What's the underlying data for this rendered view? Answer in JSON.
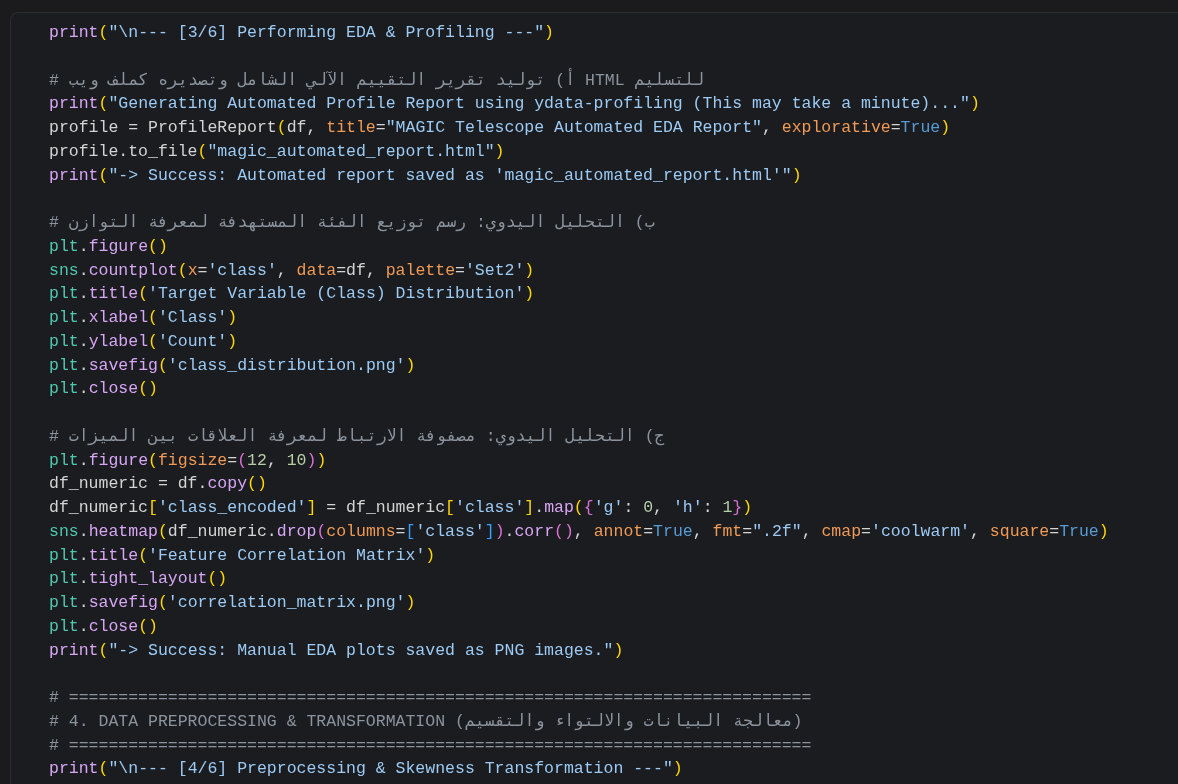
{
  "cell": {
    "lines": [
      {
        "kind": "code",
        "tokens": [
          {
            "kind": "fn",
            "text": "print"
          },
          {
            "kind": "p1",
            "text": "("
          },
          {
            "kind": "str",
            "text": "\"\\n--- [3/6] Performing EDA & Profiling ---\""
          },
          {
            "kind": "p1",
            "text": ")"
          }
        ]
      },
      {
        "kind": "blank"
      },
      {
        "kind": "comment",
        "text": "# أ) توليد تقرير التقييم الآلي الشامل وتصديره كملف ويب HTML للتسليم"
      },
      {
        "kind": "code",
        "tokens": [
          {
            "kind": "fn",
            "text": "print"
          },
          {
            "kind": "p1",
            "text": "("
          },
          {
            "kind": "str",
            "text": "\"Generating Automated Profile Report using ydata-profiling (This may take a minute)...\""
          },
          {
            "kind": "p1",
            "text": ")"
          }
        ]
      },
      {
        "kind": "code",
        "tokens": [
          {
            "kind": "plain",
            "text": "profile = ProfileReport"
          },
          {
            "kind": "p1",
            "text": "("
          },
          {
            "kind": "plain",
            "text": "df, "
          },
          {
            "kind": "kw",
            "text": "title"
          },
          {
            "kind": "plain",
            "text": "="
          },
          {
            "kind": "str",
            "text": "\"MAGIC Telescope Automated EDA Report\""
          },
          {
            "kind": "plain",
            "text": ", "
          },
          {
            "kind": "kw",
            "text": "explorative"
          },
          {
            "kind": "plain",
            "text": "="
          },
          {
            "kind": "const",
            "text": "True"
          },
          {
            "kind": "p1",
            "text": ")"
          }
        ]
      },
      {
        "kind": "code",
        "tokens": [
          {
            "kind": "plain",
            "text": "profile.to_file"
          },
          {
            "kind": "p1",
            "text": "("
          },
          {
            "kind": "str",
            "text": "\"magic_automated_report.html\""
          },
          {
            "kind": "p1",
            "text": ")"
          }
        ]
      },
      {
        "kind": "code",
        "tokens": [
          {
            "kind": "fn",
            "text": "print"
          },
          {
            "kind": "p1",
            "text": "("
          },
          {
            "kind": "str",
            "text": "\"-> Success: Automated report saved as 'magic_automated_report.html'\""
          },
          {
            "kind": "p1",
            "text": ")"
          }
        ]
      },
      {
        "kind": "blank"
      },
      {
        "kind": "comment",
        "text": "# ب) التحليل اليدوي: رسم توزيع الفئة المستهدفة لمعرفة التوازن"
      },
      {
        "kind": "code",
        "tokens": [
          {
            "kind": "mod",
            "text": "plt"
          },
          {
            "kind": "plain",
            "text": "."
          },
          {
            "kind": "fn",
            "text": "figure"
          },
          {
            "kind": "p1",
            "text": "()"
          }
        ]
      },
      {
        "kind": "code",
        "tokens": [
          {
            "kind": "mod",
            "text": "sns"
          },
          {
            "kind": "plain",
            "text": "."
          },
          {
            "kind": "fn",
            "text": "countplot"
          },
          {
            "kind": "p1",
            "text": "("
          },
          {
            "kind": "kw",
            "text": "x"
          },
          {
            "kind": "plain",
            "text": "="
          },
          {
            "kind": "str",
            "text": "'class'"
          },
          {
            "kind": "plain",
            "text": ", "
          },
          {
            "kind": "kw",
            "text": "data"
          },
          {
            "kind": "plain",
            "text": "=df, "
          },
          {
            "kind": "kw",
            "text": "palette"
          },
          {
            "kind": "plain",
            "text": "="
          },
          {
            "kind": "str",
            "text": "'Set2'"
          },
          {
            "kind": "p1",
            "text": ")"
          }
        ]
      },
      {
        "kind": "code",
        "tokens": [
          {
            "kind": "mod",
            "text": "plt"
          },
          {
            "kind": "plain",
            "text": "."
          },
          {
            "kind": "fn",
            "text": "title"
          },
          {
            "kind": "p1",
            "text": "("
          },
          {
            "kind": "str",
            "text": "'Target Variable (Class) Distribution'"
          },
          {
            "kind": "p1",
            "text": ")"
          }
        ]
      },
      {
        "kind": "code",
        "tokens": [
          {
            "kind": "mod",
            "text": "plt"
          },
          {
            "kind": "plain",
            "text": "."
          },
          {
            "kind": "fn",
            "text": "xlabel"
          },
          {
            "kind": "p1",
            "text": "("
          },
          {
            "kind": "str",
            "text": "'Class'"
          },
          {
            "kind": "p1",
            "text": ")"
          }
        ]
      },
      {
        "kind": "code",
        "tokens": [
          {
            "kind": "mod",
            "text": "plt"
          },
          {
            "kind": "plain",
            "text": "."
          },
          {
            "kind": "fn",
            "text": "ylabel"
          },
          {
            "kind": "p1",
            "text": "("
          },
          {
            "kind": "str",
            "text": "'Count'"
          },
          {
            "kind": "p1",
            "text": ")"
          }
        ]
      },
      {
        "kind": "code",
        "tokens": [
          {
            "kind": "mod",
            "text": "plt"
          },
          {
            "kind": "plain",
            "text": "."
          },
          {
            "kind": "fn",
            "text": "savefig"
          },
          {
            "kind": "p1",
            "text": "("
          },
          {
            "kind": "str",
            "text": "'class_distribution.png'"
          },
          {
            "kind": "p1",
            "text": ")"
          }
        ]
      },
      {
        "kind": "code",
        "tokens": [
          {
            "kind": "mod",
            "text": "plt"
          },
          {
            "kind": "plain",
            "text": "."
          },
          {
            "kind": "fn",
            "text": "close"
          },
          {
            "kind": "p1",
            "text": "()"
          }
        ]
      },
      {
        "kind": "blank"
      },
      {
        "kind": "comment",
        "text": "# ج) التحليل اليدوي: مصفوفة الارتباط لمعرفة العلاقات بين الميزات"
      },
      {
        "kind": "code",
        "tokens": [
          {
            "kind": "mod",
            "text": "plt"
          },
          {
            "kind": "plain",
            "text": "."
          },
          {
            "kind": "fn",
            "text": "figure"
          },
          {
            "kind": "p1",
            "text": "("
          },
          {
            "kind": "kw",
            "text": "figsize"
          },
          {
            "kind": "plain",
            "text": "="
          },
          {
            "kind": "p2",
            "text": "("
          },
          {
            "kind": "num",
            "text": "12"
          },
          {
            "kind": "plain",
            "text": ", "
          },
          {
            "kind": "num",
            "text": "10"
          },
          {
            "kind": "p2",
            "text": ")"
          },
          {
            "kind": "p1",
            "text": ")"
          }
        ]
      },
      {
        "kind": "code",
        "tokens": [
          {
            "kind": "plain",
            "text": "df_numeric = df."
          },
          {
            "kind": "fn",
            "text": "copy"
          },
          {
            "kind": "p1",
            "text": "()"
          }
        ]
      },
      {
        "kind": "code",
        "tokens": [
          {
            "kind": "plain",
            "text": "df_numeric"
          },
          {
            "kind": "p1",
            "text": "["
          },
          {
            "kind": "str",
            "text": "'class_encoded'"
          },
          {
            "kind": "p1",
            "text": "]"
          },
          {
            "kind": "plain",
            "text": " = df_numeric"
          },
          {
            "kind": "p1",
            "text": "["
          },
          {
            "kind": "str",
            "text": "'class'"
          },
          {
            "kind": "p1",
            "text": "]"
          },
          {
            "kind": "plain",
            "text": "."
          },
          {
            "kind": "fn",
            "text": "map"
          },
          {
            "kind": "p1",
            "text": "("
          },
          {
            "kind": "p2",
            "text": "{"
          },
          {
            "kind": "str",
            "text": "'g'"
          },
          {
            "kind": "plain",
            "text": ": "
          },
          {
            "kind": "num",
            "text": "0"
          },
          {
            "kind": "plain",
            "text": ", "
          },
          {
            "kind": "str",
            "text": "'h'"
          },
          {
            "kind": "plain",
            "text": ": "
          },
          {
            "kind": "num",
            "text": "1"
          },
          {
            "kind": "p2",
            "text": "}"
          },
          {
            "kind": "p1",
            "text": ")"
          }
        ]
      },
      {
        "kind": "code",
        "tokens": [
          {
            "kind": "mod",
            "text": "sns"
          },
          {
            "kind": "plain",
            "text": "."
          },
          {
            "kind": "fn",
            "text": "heatmap"
          },
          {
            "kind": "p1",
            "text": "("
          },
          {
            "kind": "plain",
            "text": "df_numeric."
          },
          {
            "kind": "fn",
            "text": "drop"
          },
          {
            "kind": "p2",
            "text": "("
          },
          {
            "kind": "kw",
            "text": "columns"
          },
          {
            "kind": "plain",
            "text": "="
          },
          {
            "kind": "p3",
            "text": "["
          },
          {
            "kind": "str",
            "text": "'class'"
          },
          {
            "kind": "p3",
            "text": "]"
          },
          {
            "kind": "p2",
            "text": ")"
          },
          {
            "kind": "plain",
            "text": "."
          },
          {
            "kind": "fn",
            "text": "corr"
          },
          {
            "kind": "p2",
            "text": "()"
          },
          {
            "kind": "plain",
            "text": ", "
          },
          {
            "kind": "kw",
            "text": "annot"
          },
          {
            "kind": "plain",
            "text": "="
          },
          {
            "kind": "const",
            "text": "True"
          },
          {
            "kind": "plain",
            "text": ", "
          },
          {
            "kind": "kw",
            "text": "fmt"
          },
          {
            "kind": "plain",
            "text": "="
          },
          {
            "kind": "str",
            "text": "\".2f\""
          },
          {
            "kind": "plain",
            "text": ", "
          },
          {
            "kind": "kw",
            "text": "cmap"
          },
          {
            "kind": "plain",
            "text": "="
          },
          {
            "kind": "str",
            "text": "'coolwarm'"
          },
          {
            "kind": "plain",
            "text": ", "
          },
          {
            "kind": "kw",
            "text": "square"
          },
          {
            "kind": "plain",
            "text": "="
          },
          {
            "kind": "const",
            "text": "True"
          },
          {
            "kind": "p1",
            "text": ")"
          }
        ]
      },
      {
        "kind": "code",
        "tokens": [
          {
            "kind": "mod",
            "text": "plt"
          },
          {
            "kind": "plain",
            "text": "."
          },
          {
            "kind": "fn",
            "text": "title"
          },
          {
            "kind": "p1",
            "text": "("
          },
          {
            "kind": "str",
            "text": "'Feature Correlation Matrix'"
          },
          {
            "kind": "p1",
            "text": ")"
          }
        ]
      },
      {
        "kind": "code",
        "tokens": [
          {
            "kind": "mod",
            "text": "plt"
          },
          {
            "kind": "plain",
            "text": "."
          },
          {
            "kind": "fn",
            "text": "tight_layout"
          },
          {
            "kind": "p1",
            "text": "()"
          }
        ]
      },
      {
        "kind": "code",
        "tokens": [
          {
            "kind": "mod",
            "text": "plt"
          },
          {
            "kind": "plain",
            "text": "."
          },
          {
            "kind": "fn",
            "text": "savefig"
          },
          {
            "kind": "p1",
            "text": "("
          },
          {
            "kind": "str",
            "text": "'correlation_matrix.png'"
          },
          {
            "kind": "p1",
            "text": ")"
          }
        ]
      },
      {
        "kind": "code",
        "tokens": [
          {
            "kind": "mod",
            "text": "plt"
          },
          {
            "kind": "plain",
            "text": "."
          },
          {
            "kind": "fn",
            "text": "close"
          },
          {
            "kind": "p1",
            "text": "()"
          }
        ]
      },
      {
        "kind": "code",
        "tokens": [
          {
            "kind": "fn",
            "text": "print"
          },
          {
            "kind": "p1",
            "text": "("
          },
          {
            "kind": "str",
            "text": "\"-> Success: Manual EDA plots saved as PNG images.\""
          },
          {
            "kind": "p1",
            "text": ")"
          }
        ]
      },
      {
        "kind": "blank"
      },
      {
        "kind": "comment",
        "text": "# ==========================================================================="
      },
      {
        "kind": "comment",
        "text": "# 4. DATA PREPROCESSING & TRANSFORMATION (معالجة البيانات والالتواء والتقسيم)"
      },
      {
        "kind": "comment",
        "text": "# ==========================================================================="
      },
      {
        "kind": "code",
        "tokens": [
          {
            "kind": "fn",
            "text": "print"
          },
          {
            "kind": "p1",
            "text": "("
          },
          {
            "kind": "str",
            "text": "\"\\n--- [4/6] Preprocessing & Skewness Transformation ---\""
          },
          {
            "kind": "p1",
            "text": ")"
          }
        ]
      }
    ]
  }
}
